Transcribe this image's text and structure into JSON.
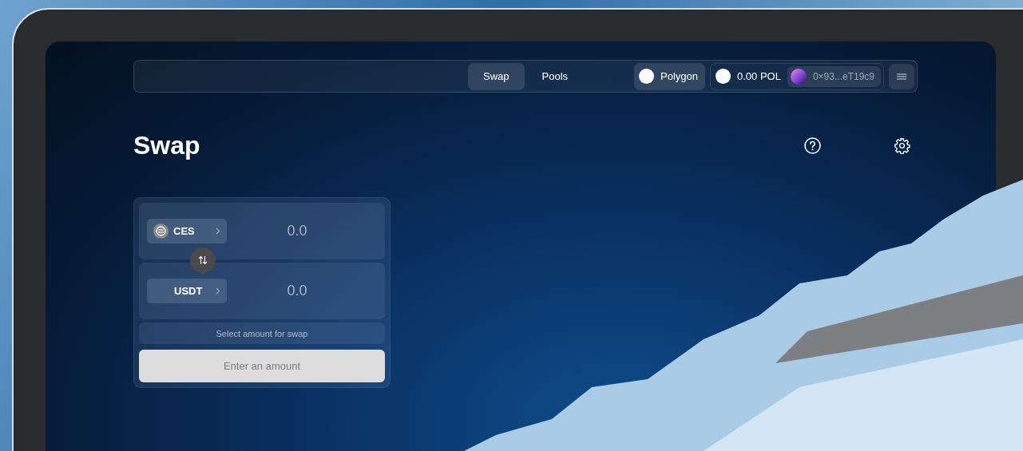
{
  "nav": {
    "tabs": [
      {
        "label": "Swap",
        "selected": true
      },
      {
        "label": "Pools",
        "selected": false
      }
    ],
    "network": "Polygon",
    "balance": "0.00 POL",
    "address": "0×93...eT19c9"
  },
  "title": "Swap",
  "swap": {
    "tokens": [
      {
        "symbol": "CES",
        "amount": "0.0",
        "has_icon": true
      },
      {
        "symbol": "USDT",
        "amount": "0.0",
        "has_icon": false
      }
    ],
    "hint": "Select amount for swap",
    "button": {
      "label": "Enter an amount",
      "disabled": true
    }
  }
}
